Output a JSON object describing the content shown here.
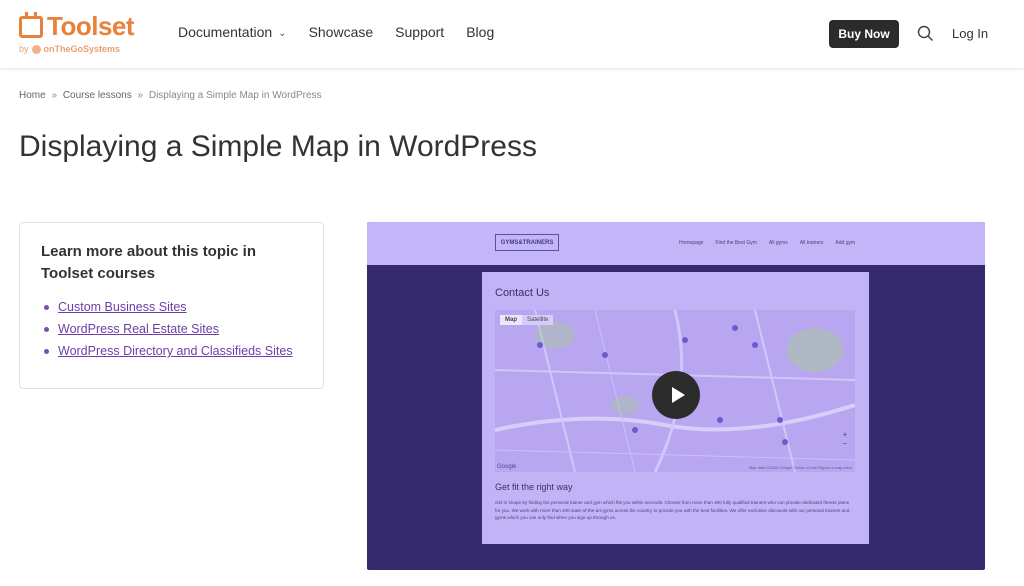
{
  "header": {
    "logo_text": "Toolset",
    "logo_by": "by",
    "logo_company": "onTheGoSystems",
    "nav": [
      {
        "label": "Documentation",
        "has_dropdown": true
      },
      {
        "label": "Showcase"
      },
      {
        "label": "Support"
      },
      {
        "label": "Blog"
      }
    ],
    "buy_label": "Buy Now",
    "login_label": "Log In",
    "search_icon": "search-icon"
  },
  "breadcrumb": {
    "home": "Home",
    "sep": "»",
    "section": "Course lessons",
    "current": "Displaying a Simple Map in WordPress"
  },
  "page_title": "Displaying a Simple Map in WordPress",
  "sidebar": {
    "heading": "Learn more about this topic in Toolset courses",
    "links": [
      "Custom Business Sites",
      "WordPress Real Estate Sites",
      "WordPress Directory and Classifieds Sites"
    ]
  },
  "video": {
    "site_logo": "GYMS&TRAINERS",
    "site_nav": [
      "Homepage",
      "Find the Best Gym",
      "All gyms",
      "All trainers",
      "Add gym"
    ],
    "contact_heading": "Contact Us",
    "map_tabs": [
      "Map",
      "Satellite"
    ],
    "map_google": "Google",
    "map_credit": "Map data ©2019 Google   Terms of Use   Report a map error",
    "fit_heading": "Get fit the right way",
    "fit_body": "Get in shape by finding the personal trainer and gym which fits you within seconds. Choose from more than 400 fully qualified trainers who can provide dedicated fitness plans for you. We work with more than 400 state-of-the-art gyms across the country to provide you with the best facilities. We offer exclusive discounts with our personal trainers and gyms which you can only find when you sign up through us.",
    "zoom_plus": "+",
    "zoom_minus": "−"
  },
  "colors": {
    "brand": "#e8823a",
    "link": "#6b3fa8",
    "video_bg": "#352a6e",
    "panel": "#c2b3f7"
  }
}
